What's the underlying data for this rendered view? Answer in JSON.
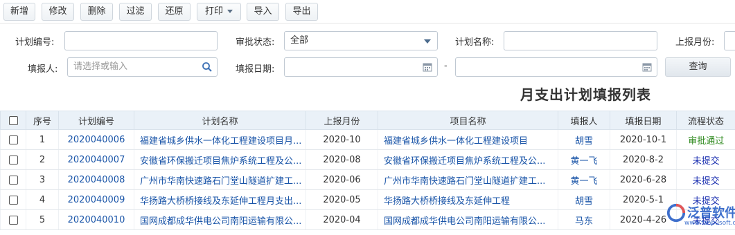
{
  "toolbar": {
    "buttons": [
      "新增",
      "修改",
      "删除",
      "过滤",
      "还原",
      "打印",
      "导入",
      "导出"
    ]
  },
  "filters": {
    "plan_no_label": "计划编号:",
    "status_label": "审批状态:",
    "status_value": "全部",
    "plan_name_label": "计划名称:",
    "month_label": "上报月份:",
    "reporter_label": "填报人:",
    "reporter_placeholder": "请选择或输入",
    "date_label": "填报日期:",
    "date_sep": "-",
    "query_label": "查询"
  },
  "title": "月支出计划填报列表",
  "table": {
    "headers": [
      "序号",
      "计划编号",
      "计划名称",
      "上报月份",
      "项目名称",
      "填报人",
      "填报日期",
      "流程状态"
    ],
    "rows": [
      {
        "no": "1",
        "code": "2020040006",
        "plan": "福建省城乡供水一体化工程建设项目月...",
        "month": "2020-10",
        "project": "福建省城乡供水一体化工程建设项目",
        "reporter": "胡雪",
        "date": "2020-10-1",
        "status": "审批通过",
        "ok": true
      },
      {
        "no": "2",
        "code": "2020040007",
        "plan": "安徽省环保搬迁项目焦炉系统工程及公...",
        "month": "2020-08",
        "project": "安徽省环保搬迁项目焦炉系统工程及公...",
        "reporter": "黄一飞",
        "date": "2020-8-2",
        "status": "未提交",
        "ok": false
      },
      {
        "no": "3",
        "code": "2020040008",
        "plan": "广州市华南快速路石门堂山隧道扩建工...",
        "month": "2020-06",
        "project": "广州市华南快速路石门堂山隧道扩建工...",
        "reporter": "黄一飞",
        "date": "2020-6-28",
        "status": "未提交",
        "ok": false
      },
      {
        "no": "4",
        "code": "2020040009",
        "plan": "华扬路大桥桥接线及东延伸工程月支出...",
        "month": "2020-05",
        "project": "华扬路大桥桥接线及东延伸工程",
        "reporter": "胡雪",
        "date": "2020-5-1",
        "status": "未提交",
        "ok": false
      },
      {
        "no": "5",
        "code": "2020040010",
        "plan": "国网成都成华供电公司南阳运输有限公...",
        "month": "2020-04",
        "project": "国网成都成华供电公司南阳运输有限公...",
        "reporter": "马东",
        "date": "2020-4-26",
        "status": "未提交",
        "ok": false
      }
    ]
  },
  "watermark": {
    "brand": "泛普软件",
    "url": "www.fanpusoft.com"
  }
}
